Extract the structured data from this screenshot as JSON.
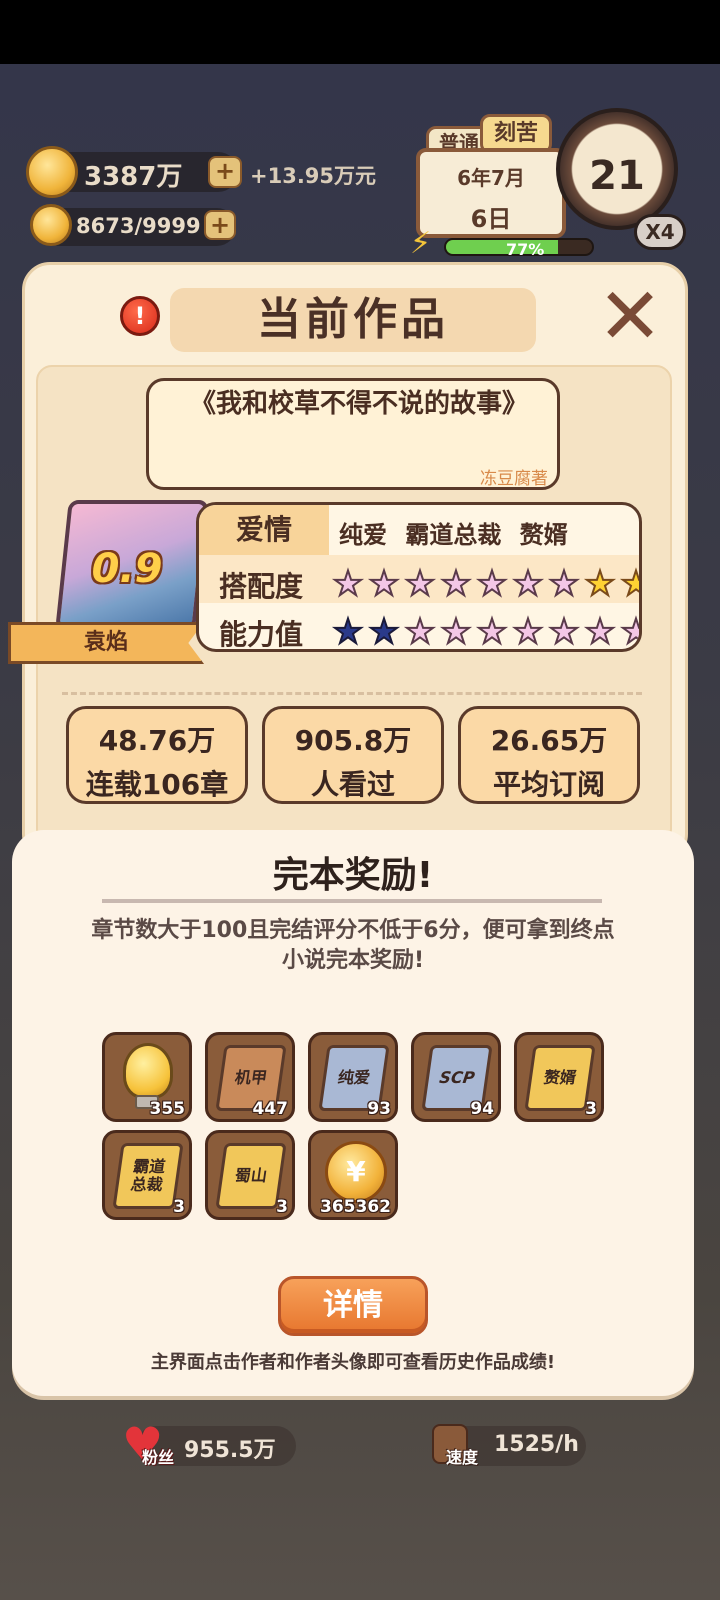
{
  "hud": {
    "money": "3387万",
    "income": "+13.95万元",
    "energy": "8673/9999",
    "mode_tags": [
      "普通",
      "刻苦"
    ],
    "calendar_month": "6年7月",
    "calendar_day": "6日",
    "progress": "77%",
    "progress_fraction": 0.77,
    "clock_value": "21",
    "speed_multiplier": "X4"
  },
  "panel": {
    "title": "当前作品",
    "alert_glyph": "!",
    "close_glyph": "✕",
    "book_title": "《我和校草不得不说的故事》",
    "author_line": "冻豆腐著",
    "cover_score": "0.9",
    "author_name": "袁焰",
    "genre": "爱情",
    "tags": "纯爱 霸道总裁 赘婿",
    "match_label": "搭配度",
    "ability_label": "能力值",
    "match_stars": {
      "pastel": 7,
      "gold": 2
    },
    "ability_stars": {
      "navy": 2,
      "pastel": 7
    },
    "stats": [
      {
        "value": "48.76万",
        "label": "连载106章"
      },
      {
        "value": "905.8万",
        "label": "人看过"
      },
      {
        "value": "26.65万",
        "label": "平均订阅"
      }
    ]
  },
  "reward": {
    "title": "完本奖励!",
    "description": "章节数大于100且完结评分不低于6分，便可拿到终点小说完本奖励!",
    "items": [
      {
        "icon": "lightbulb-icon",
        "label": "",
        "count": "355"
      },
      {
        "icon": "book-icon",
        "label": "机甲",
        "count": "447"
      },
      {
        "icon": "book-icon",
        "label": "纯爱",
        "count": "93"
      },
      {
        "icon": "book-icon",
        "label": "SCP",
        "count": "94"
      },
      {
        "icon": "book-icon",
        "label": "赘婿",
        "count": "3"
      },
      {
        "icon": "book-icon",
        "label": "霸道总裁",
        "count": "3"
      },
      {
        "icon": "book-icon",
        "label": "蜀山",
        "count": "3"
      },
      {
        "icon": "coin-icon",
        "label": "",
        "count": "365362"
      }
    ],
    "detail_button": "详情",
    "tip": "主界面点击作者和作者头像即可查看历史作品成绩!"
  },
  "bottom": {
    "fans_label": "粉丝",
    "fans_value": "955.5万",
    "speed_label": "速度",
    "speed_value": "1525/h"
  }
}
